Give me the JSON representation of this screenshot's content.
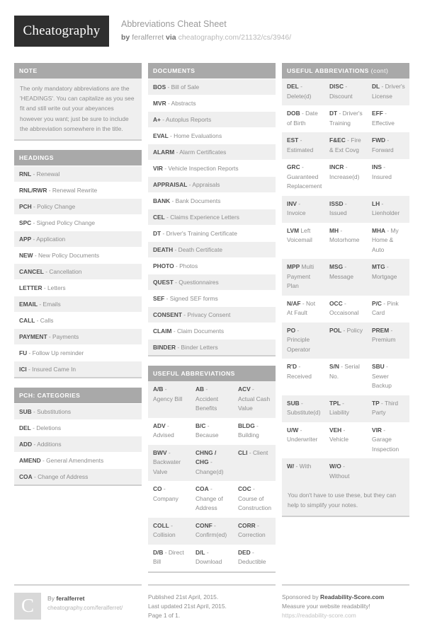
{
  "header": {
    "logo": "Cheatography",
    "title": "Abbreviations Cheat Sheet",
    "by_label": "by",
    "author": "feralferret",
    "via_label": "via",
    "url": "cheatography.com/21132/cs/3946/"
  },
  "note": {
    "title": "NOTE",
    "body": "The only mandatory abbreviations are the 'HEADINGS'. You can capitalize as you see fit and still write out your abeyances however you want; just be sure to include the abbreviation somewhere in the title."
  },
  "headings": {
    "title": "HEADINGS",
    "rows": [
      {
        "abbr": "RNL",
        "desc": " - Renewal"
      },
      {
        "abbr": "RNL/RWR",
        "desc": " - Renewal Rewrite"
      },
      {
        "abbr": "PCH",
        "desc": " - Policy Change"
      },
      {
        "abbr": "SPC",
        "desc": " - Signed Policy Change"
      },
      {
        "abbr": "APP",
        "desc": " - Application"
      },
      {
        "abbr": "NEW",
        "desc": " - New Policy Documents"
      },
      {
        "abbr": "CANCEL",
        "desc": " - Cancellation"
      },
      {
        "abbr": "LETTER",
        "desc": " - Letters"
      },
      {
        "abbr": "EMAIL",
        "desc": " - Emails"
      },
      {
        "abbr": "CALL",
        "desc": " - Calls"
      },
      {
        "abbr": "PAYMENT",
        "desc": " - Payments"
      },
      {
        "abbr": "FU",
        "desc": " - Follow Up reminder"
      },
      {
        "abbr": "ICI",
        "desc": " - Insured Came In"
      }
    ]
  },
  "pch_categories": {
    "title": "PCH: CATEGORIES",
    "rows": [
      {
        "abbr": "SUB",
        "desc": " - Substitutions"
      },
      {
        "abbr": "DEL",
        "desc": " - Deletions"
      },
      {
        "abbr": "ADD",
        "desc": " - Additions"
      },
      {
        "abbr": "AMEND",
        "desc": " - General Amendments"
      },
      {
        "abbr": "COA",
        "desc": " - Change of Address"
      }
    ]
  },
  "documents": {
    "title": "DOCUMENTS",
    "rows": [
      {
        "abbr": "BOS",
        "desc": " - Bill of Sale"
      },
      {
        "abbr": "MVR",
        "desc": " - Abstracts"
      },
      {
        "abbr": "A+",
        "desc": " - Autoplus Reports"
      },
      {
        "abbr": "EVAL",
        "desc": " - Home Evaluations"
      },
      {
        "abbr": "ALARM",
        "desc": " - Alarm Certificates"
      },
      {
        "abbr": "VIR",
        "desc": " - Vehicle Inspection Reports"
      },
      {
        "abbr": "APPRAISAL",
        "desc": " - Appraisals"
      },
      {
        "abbr": "BANK",
        "desc": " - Bank Documents"
      },
      {
        "abbr": "CEL",
        "desc": " - Claims Experience Letters"
      },
      {
        "abbr": "DT",
        "desc": " - Driver's Training Certificate"
      },
      {
        "abbr": "DEATH",
        "desc": " - Death Certificate"
      },
      {
        "abbr": "PHOTO",
        "desc": " - Photos"
      },
      {
        "abbr": "QUEST",
        "desc": " - Questionnaires"
      },
      {
        "abbr": "SEF",
        "desc": " - Signed SEF forms"
      },
      {
        "abbr": "CONSENT",
        "desc": " - Privacy Consent"
      },
      {
        "abbr": "CLAIM",
        "desc": " - Claim Documents"
      },
      {
        "abbr": "BINDER",
        "desc": " - Binder Letters"
      }
    ]
  },
  "useful_abbreviations": {
    "title": "USEFUL ABBREVIATIONS",
    "rows": [
      [
        {
          "abbr": "A/B",
          "desc": " - Agency Bill"
        },
        {
          "abbr": "AB",
          "desc": " - Accident Benefits"
        },
        {
          "abbr": "ACV",
          "desc": " - Actual Cash Value"
        }
      ],
      [
        {
          "abbr": "ADV",
          "desc": " - Advised"
        },
        {
          "abbr": "B/C",
          "desc": " - Because"
        },
        {
          "abbr": "BLDG",
          "desc": " - Building"
        }
      ],
      [
        {
          "abbr": "BWV",
          "desc": " - Backwater Valve"
        },
        {
          "abbr": "CHNG / CHG",
          "desc": " - Change(d)"
        },
        {
          "abbr": "CLI",
          "desc": " - Client"
        }
      ],
      [
        {
          "abbr": "CO",
          "desc": " - Company"
        },
        {
          "abbr": "COA",
          "desc": " - Change of Address"
        },
        {
          "abbr": "COC",
          "desc": " - Course of Construction"
        }
      ],
      [
        {
          "abbr": "COLL",
          "desc": " - Collision"
        },
        {
          "abbr": "CONF",
          "desc": " - Confirm(ed)"
        },
        {
          "abbr": "CORR",
          "desc": " - Correction"
        }
      ],
      [
        {
          "abbr": "D/B",
          "desc": " - Direct Bill"
        },
        {
          "abbr": "D/L",
          "desc": " - Download"
        },
        {
          "abbr": "DED",
          "desc": " - Deductible"
        }
      ]
    ]
  },
  "useful_abbreviations_cont": {
    "title": "USEFUL ABBREVIATIONS",
    "title_suffix": " (cont)",
    "rows": [
      [
        {
          "abbr": "DEL",
          "desc": " - Delete(d)"
        },
        {
          "abbr": "DISC",
          "desc": " - Discount"
        },
        {
          "abbr": "DL",
          "desc": " - Driver's License"
        }
      ],
      [
        {
          "abbr": "DOB",
          "desc": " - Date of Birth"
        },
        {
          "abbr": "DT",
          "desc": " - Driver's Training"
        },
        {
          "abbr": "EFF",
          "desc": " - Effective"
        }
      ],
      [
        {
          "abbr": "EST",
          "desc": " - Estimated"
        },
        {
          "abbr": "F&EC",
          "desc": " - Fire & Ext Covg"
        },
        {
          "abbr": "FWD",
          "desc": " - Forward"
        }
      ],
      [
        {
          "abbr": "GRC",
          "desc": " - Guaranteed Replacement"
        },
        {
          "abbr": "INCR",
          "desc": " - Increase(d)"
        },
        {
          "abbr": "INS",
          "desc": " - Insured"
        }
      ],
      [
        {
          "abbr": "INV",
          "desc": " - Invoice"
        },
        {
          "abbr": "ISSD",
          "desc": " - Issued"
        },
        {
          "abbr": "LH",
          "desc": " - Lienholder"
        }
      ],
      [
        {
          "abbr": "LVM",
          "desc": " Left Voicemail"
        },
        {
          "abbr": "MH",
          "desc": " - Motorhome"
        },
        {
          "abbr": "MHA",
          "desc": " - My Home & Auto"
        }
      ],
      [
        {
          "abbr": "MPP",
          "desc": " Multi Payment Plan"
        },
        {
          "abbr": "MSG",
          "desc": " - Message"
        },
        {
          "abbr": "MTG",
          "desc": " - Mortgage"
        }
      ],
      [
        {
          "abbr": "N/AF",
          "desc": " - Not At Fault"
        },
        {
          "abbr": "OCC",
          "desc": " - Occaisonal"
        },
        {
          "abbr": "P/C",
          "desc": " - Pink Card"
        }
      ],
      [
        {
          "abbr": "PO",
          "desc": " - Principle Operator"
        },
        {
          "abbr": "POL",
          "desc": " - Policy"
        },
        {
          "abbr": "PREM",
          "desc": " - Premium"
        }
      ],
      [
        {
          "abbr": "R'D",
          "desc": " - Received"
        },
        {
          "abbr": "S/N",
          "desc": " - Serial No."
        },
        {
          "abbr": "SBU",
          "desc": " - Sewer Backup"
        }
      ],
      [
        {
          "abbr": "SUB",
          "desc": " - Substitute(d)"
        },
        {
          "abbr": "TPL",
          "desc": " - Liability"
        },
        {
          "abbr": "TP",
          "desc": " - Third Party"
        }
      ],
      [
        {
          "abbr": "U/W",
          "desc": " - Underwriter"
        },
        {
          "abbr": "VEH",
          "desc": " - Vehicle"
        },
        {
          "abbr": "VIR",
          "desc": " - Garage Inspection"
        }
      ],
      [
        {
          "abbr": "W/",
          "desc": " - With"
        },
        {
          "abbr": "W/O",
          "desc": " - Without"
        },
        {
          "abbr": "",
          "desc": ""
        }
      ]
    ],
    "tail_note": "You don't have to use these, but they can help to simplify your notes."
  },
  "footer": {
    "avatar_letter": "C",
    "by_label": "By ",
    "author": "feralferret",
    "author_url": "cheatography.com/feralferret/",
    "published": "Published 21st April, 2015.",
    "updated": "Last updated 21st April, 2015.",
    "page": "Page 1 of 1.",
    "sponsor_prefix": "Sponsored by ",
    "sponsor_name": "Readability-Score.com",
    "sponsor_tagline": "Measure your website readability!",
    "sponsor_url": "https://readability-score.com"
  }
}
